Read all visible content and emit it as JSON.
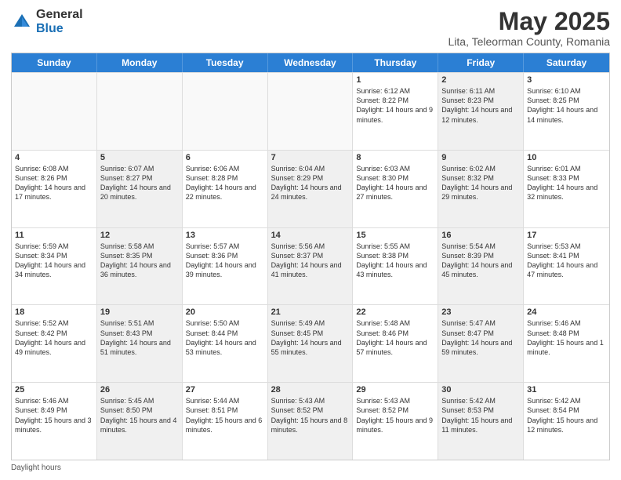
{
  "header": {
    "logo_general": "General",
    "logo_blue": "Blue",
    "month_title": "May 2025",
    "location": "Lita, Teleorman County, Romania"
  },
  "days_of_week": [
    "Sunday",
    "Monday",
    "Tuesday",
    "Wednesday",
    "Thursday",
    "Friday",
    "Saturday"
  ],
  "rows": [
    [
      {
        "day": "",
        "sunrise": "",
        "sunset": "",
        "daylight": "",
        "shaded": false,
        "empty": true
      },
      {
        "day": "",
        "sunrise": "",
        "sunset": "",
        "daylight": "",
        "shaded": false,
        "empty": true
      },
      {
        "day": "",
        "sunrise": "",
        "sunset": "",
        "daylight": "",
        "shaded": false,
        "empty": true
      },
      {
        "day": "",
        "sunrise": "",
        "sunset": "",
        "daylight": "",
        "shaded": false,
        "empty": true
      },
      {
        "day": "1",
        "sunrise": "Sunrise: 6:12 AM",
        "sunset": "Sunset: 8:22 PM",
        "daylight": "Daylight: 14 hours and 9 minutes.",
        "shaded": false,
        "empty": false
      },
      {
        "day": "2",
        "sunrise": "Sunrise: 6:11 AM",
        "sunset": "Sunset: 8:23 PM",
        "daylight": "Daylight: 14 hours and 12 minutes.",
        "shaded": true,
        "empty": false
      },
      {
        "day": "3",
        "sunrise": "Sunrise: 6:10 AM",
        "sunset": "Sunset: 8:25 PM",
        "daylight": "Daylight: 14 hours and 14 minutes.",
        "shaded": false,
        "empty": false
      }
    ],
    [
      {
        "day": "4",
        "sunrise": "Sunrise: 6:08 AM",
        "sunset": "Sunset: 8:26 PM",
        "daylight": "Daylight: 14 hours and 17 minutes.",
        "shaded": false,
        "empty": false
      },
      {
        "day": "5",
        "sunrise": "Sunrise: 6:07 AM",
        "sunset": "Sunset: 8:27 PM",
        "daylight": "Daylight: 14 hours and 20 minutes.",
        "shaded": true,
        "empty": false
      },
      {
        "day": "6",
        "sunrise": "Sunrise: 6:06 AM",
        "sunset": "Sunset: 8:28 PM",
        "daylight": "Daylight: 14 hours and 22 minutes.",
        "shaded": false,
        "empty": false
      },
      {
        "day": "7",
        "sunrise": "Sunrise: 6:04 AM",
        "sunset": "Sunset: 8:29 PM",
        "daylight": "Daylight: 14 hours and 24 minutes.",
        "shaded": true,
        "empty": false
      },
      {
        "day": "8",
        "sunrise": "Sunrise: 6:03 AM",
        "sunset": "Sunset: 8:30 PM",
        "daylight": "Daylight: 14 hours and 27 minutes.",
        "shaded": false,
        "empty": false
      },
      {
        "day": "9",
        "sunrise": "Sunrise: 6:02 AM",
        "sunset": "Sunset: 8:32 PM",
        "daylight": "Daylight: 14 hours and 29 minutes.",
        "shaded": true,
        "empty": false
      },
      {
        "day": "10",
        "sunrise": "Sunrise: 6:01 AM",
        "sunset": "Sunset: 8:33 PM",
        "daylight": "Daylight: 14 hours and 32 minutes.",
        "shaded": false,
        "empty": false
      }
    ],
    [
      {
        "day": "11",
        "sunrise": "Sunrise: 5:59 AM",
        "sunset": "Sunset: 8:34 PM",
        "daylight": "Daylight: 14 hours and 34 minutes.",
        "shaded": false,
        "empty": false
      },
      {
        "day": "12",
        "sunrise": "Sunrise: 5:58 AM",
        "sunset": "Sunset: 8:35 PM",
        "daylight": "Daylight: 14 hours and 36 minutes.",
        "shaded": true,
        "empty": false
      },
      {
        "day": "13",
        "sunrise": "Sunrise: 5:57 AM",
        "sunset": "Sunset: 8:36 PM",
        "daylight": "Daylight: 14 hours and 39 minutes.",
        "shaded": false,
        "empty": false
      },
      {
        "day": "14",
        "sunrise": "Sunrise: 5:56 AM",
        "sunset": "Sunset: 8:37 PM",
        "daylight": "Daylight: 14 hours and 41 minutes.",
        "shaded": true,
        "empty": false
      },
      {
        "day": "15",
        "sunrise": "Sunrise: 5:55 AM",
        "sunset": "Sunset: 8:38 PM",
        "daylight": "Daylight: 14 hours and 43 minutes.",
        "shaded": false,
        "empty": false
      },
      {
        "day": "16",
        "sunrise": "Sunrise: 5:54 AM",
        "sunset": "Sunset: 8:39 PM",
        "daylight": "Daylight: 14 hours and 45 minutes.",
        "shaded": true,
        "empty": false
      },
      {
        "day": "17",
        "sunrise": "Sunrise: 5:53 AM",
        "sunset": "Sunset: 8:41 PM",
        "daylight": "Daylight: 14 hours and 47 minutes.",
        "shaded": false,
        "empty": false
      }
    ],
    [
      {
        "day": "18",
        "sunrise": "Sunrise: 5:52 AM",
        "sunset": "Sunset: 8:42 PM",
        "daylight": "Daylight: 14 hours and 49 minutes.",
        "shaded": false,
        "empty": false
      },
      {
        "day": "19",
        "sunrise": "Sunrise: 5:51 AM",
        "sunset": "Sunset: 8:43 PM",
        "daylight": "Daylight: 14 hours and 51 minutes.",
        "shaded": true,
        "empty": false
      },
      {
        "day": "20",
        "sunrise": "Sunrise: 5:50 AM",
        "sunset": "Sunset: 8:44 PM",
        "daylight": "Daylight: 14 hours and 53 minutes.",
        "shaded": false,
        "empty": false
      },
      {
        "day": "21",
        "sunrise": "Sunrise: 5:49 AM",
        "sunset": "Sunset: 8:45 PM",
        "daylight": "Daylight: 14 hours and 55 minutes.",
        "shaded": true,
        "empty": false
      },
      {
        "day": "22",
        "sunrise": "Sunrise: 5:48 AM",
        "sunset": "Sunset: 8:46 PM",
        "daylight": "Daylight: 14 hours and 57 minutes.",
        "shaded": false,
        "empty": false
      },
      {
        "day": "23",
        "sunrise": "Sunrise: 5:47 AM",
        "sunset": "Sunset: 8:47 PM",
        "daylight": "Daylight: 14 hours and 59 minutes.",
        "shaded": true,
        "empty": false
      },
      {
        "day": "24",
        "sunrise": "Sunrise: 5:46 AM",
        "sunset": "Sunset: 8:48 PM",
        "daylight": "Daylight: 15 hours and 1 minute.",
        "shaded": false,
        "empty": false
      }
    ],
    [
      {
        "day": "25",
        "sunrise": "Sunrise: 5:46 AM",
        "sunset": "Sunset: 8:49 PM",
        "daylight": "Daylight: 15 hours and 3 minutes.",
        "shaded": false,
        "empty": false
      },
      {
        "day": "26",
        "sunrise": "Sunrise: 5:45 AM",
        "sunset": "Sunset: 8:50 PM",
        "daylight": "Daylight: 15 hours and 4 minutes.",
        "shaded": true,
        "empty": false
      },
      {
        "day": "27",
        "sunrise": "Sunrise: 5:44 AM",
        "sunset": "Sunset: 8:51 PM",
        "daylight": "Daylight: 15 hours and 6 minutes.",
        "shaded": false,
        "empty": false
      },
      {
        "day": "28",
        "sunrise": "Sunrise: 5:43 AM",
        "sunset": "Sunset: 8:52 PM",
        "daylight": "Daylight: 15 hours and 8 minutes.",
        "shaded": true,
        "empty": false
      },
      {
        "day": "29",
        "sunrise": "Sunrise: 5:43 AM",
        "sunset": "Sunset: 8:52 PM",
        "daylight": "Daylight: 15 hours and 9 minutes.",
        "shaded": false,
        "empty": false
      },
      {
        "day": "30",
        "sunrise": "Sunrise: 5:42 AM",
        "sunset": "Sunset: 8:53 PM",
        "daylight": "Daylight: 15 hours and 11 minutes.",
        "shaded": true,
        "empty": false
      },
      {
        "day": "31",
        "sunrise": "Sunrise: 5:42 AM",
        "sunset": "Sunset: 8:54 PM",
        "daylight": "Daylight: 15 hours and 12 minutes.",
        "shaded": false,
        "empty": false
      }
    ]
  ],
  "footer": {
    "note": "Daylight hours"
  }
}
